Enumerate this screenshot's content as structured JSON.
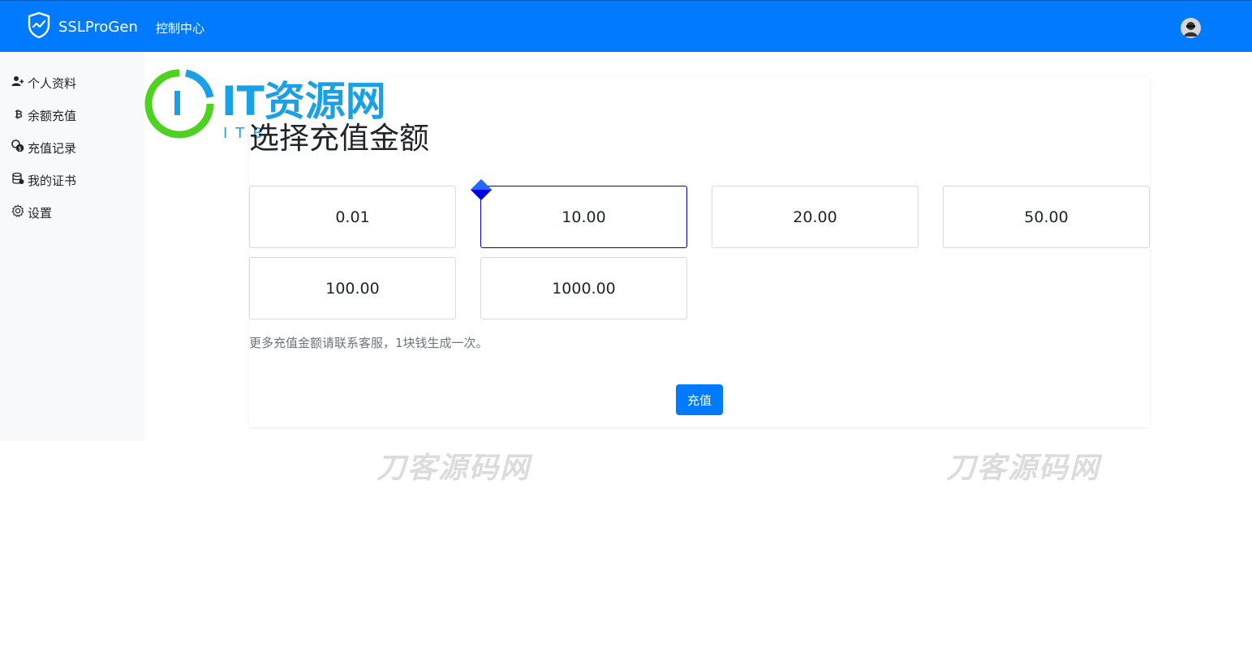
{
  "header": {
    "brand_name": "SSLProGen",
    "nav_link": "控制中心",
    "colors": {
      "bar": "#007bff"
    }
  },
  "sidebar": {
    "items": [
      {
        "label": "个人资料",
        "icon": "user-plus-icon"
      },
      {
        "label": "余额充值",
        "icon": "bitcoin-icon"
      },
      {
        "label": "充值记录",
        "icon": "coins-icon"
      },
      {
        "label": "我的证书",
        "icon": "database-icon"
      },
      {
        "label": "设置",
        "icon": "gear-icon"
      }
    ]
  },
  "main": {
    "title": "选择充值金额",
    "amounts": [
      "0.01",
      "10.00",
      "20.00",
      "50.00",
      "100.00",
      "1000.00"
    ],
    "selected_amount": "10.00",
    "note": "更多充值金额请联系客服，1块钱生成一次。",
    "submit_label": "充值"
  },
  "watermarks": {
    "logo_main": "IT资源网",
    "logo_sub": "ITB",
    "text_left": "刀客源码网",
    "text_right": "刀客源码网"
  }
}
